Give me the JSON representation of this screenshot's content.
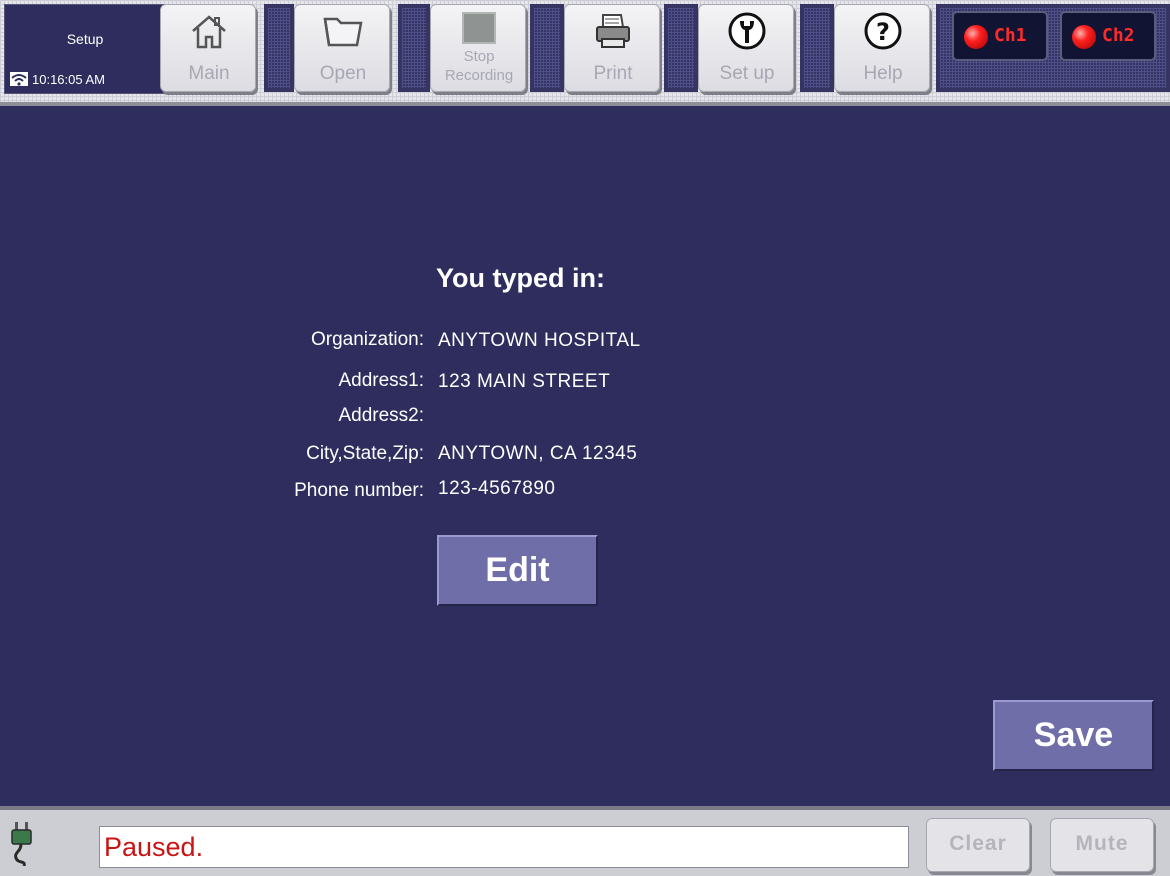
{
  "toolbar": {
    "screen_title": "Setup",
    "clock": "10:16:05 AM",
    "buttons": {
      "main": "Main",
      "open": "Open",
      "stop_recording": "Stop Recording",
      "print": "Print",
      "setup": "Set up",
      "help": "Help"
    },
    "channels": {
      "ch1": "Ch1",
      "ch2": "Ch2",
      "led_color": "#ff2020"
    }
  },
  "main": {
    "heading": "You typed in:",
    "fields": [
      {
        "label": "Organization:",
        "value": "ANYTOWN HOSPITAL"
      },
      {
        "label": "Address1:",
        "value": "123 MAIN STREET"
      },
      {
        "label": "Address2:",
        "value": ""
      },
      {
        "label": "City,State,Zip:",
        "value": "ANYTOWN, CA 12345"
      },
      {
        "label": "Phone number:",
        "value": "123-4567890"
      }
    ],
    "edit_label": "Edit",
    "save_label": "Save"
  },
  "statusbar": {
    "message": "Paused.",
    "clear_label": "Clear",
    "mute_label": "Mute"
  },
  "colors": {
    "background": "#2e2d5e",
    "button": "#6f6ea8",
    "status_text": "#c81414"
  }
}
